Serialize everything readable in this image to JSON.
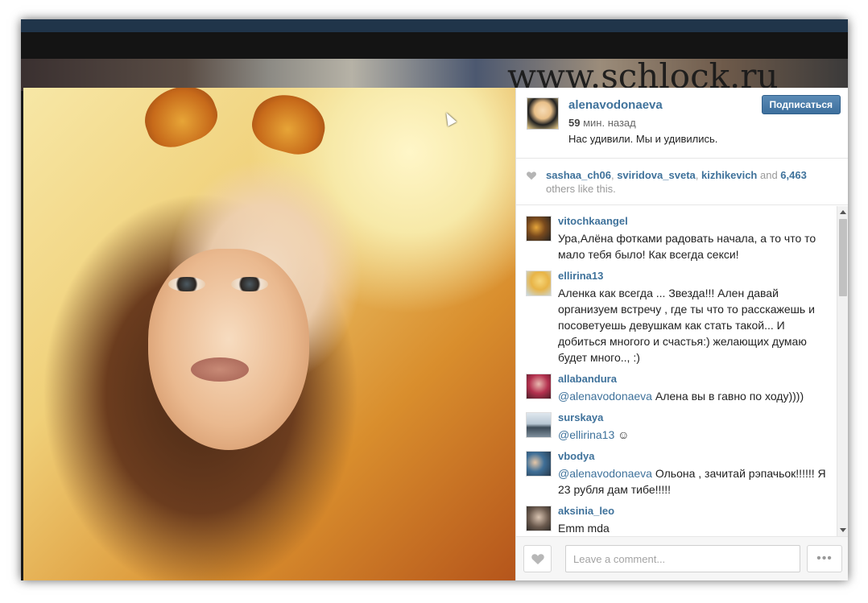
{
  "watermark": "www.schlock.ru",
  "post": {
    "owner": "alenavodonaeva",
    "time_value": "59",
    "time_rest": "мин. назад",
    "caption": "Нас удивили. Мы и удивились.",
    "follow_label": "Подписаться"
  },
  "likes": {
    "users": [
      "sashaa_ch06",
      "sviridova_sveta",
      "kizhikevich"
    ],
    "sep1": ", ",
    "sep2": ", ",
    "and": " and ",
    "count": "6,463",
    "suffix": " others like this."
  },
  "comments": [
    {
      "user": "vitochkaangel",
      "text": "Ура,Алёна фотками радовать начала, а то что то мало тебя было! Как всегда секси!"
    },
    {
      "user": "ellirina13",
      "text": "Аленка как всегда ... Звезда!!! Ален давай организуем встречу , где ты что то расскажешь и посоветуешь девушкам как стать такой... И добиться многого и счастья:) желающих думаю будет много.., :)"
    },
    {
      "user": "allabandura",
      "mention": "@alenavodonaeva",
      "text": " Алена вы в гавно по ходу))))"
    },
    {
      "user": "surskaya",
      "mention": "@ellirina13",
      "text": " ☺"
    },
    {
      "user": "vbodya",
      "mention": "@alenavodonaeva",
      "text": " Ольона , зачитай рэпачьок!!!!!! Я 23 рубля дам тибе!!!!!"
    },
    {
      "user": "aksinia_leo",
      "text": "Emm mda"
    }
  ],
  "footer": {
    "comment_placeholder": "Leave a comment...",
    "more_label": "•••"
  },
  "colors": {
    "link": "#3f729b",
    "button": "#3d6f9d"
  }
}
